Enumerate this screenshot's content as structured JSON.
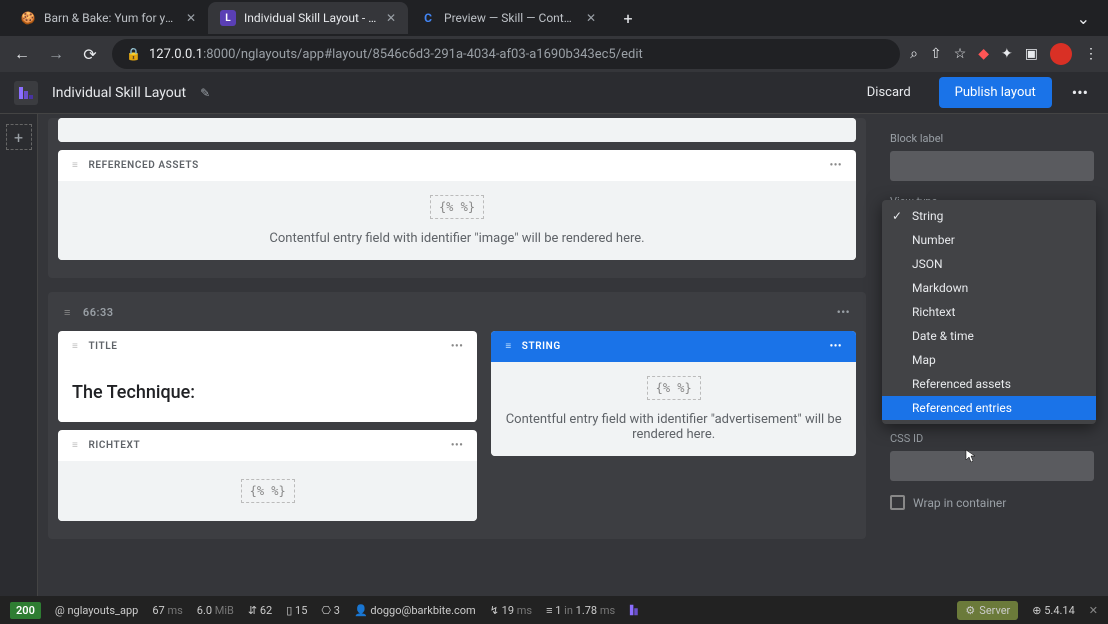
{
  "tabs": [
    {
      "title": "Barn & Bake: Yum for your Pup",
      "favicon": "🍪"
    },
    {
      "title": "Individual Skill Layout - Netge",
      "favicon": "L"
    },
    {
      "title": "Preview — Skill — Content Mod",
      "favicon": "C"
    }
  ],
  "address": {
    "host": "127.0.0.1",
    "port": ":8000",
    "path": "/nglayouts/app#layout/8546c6d3-291a-4034-af03-a1690b343ec5/edit"
  },
  "header": {
    "title": "Individual Skill Layout",
    "discard": "Discard",
    "publish": "Publish layout"
  },
  "blocks": {
    "ref_assets": {
      "label": "REFERENCED ASSETS",
      "body": "Contentful entry field with identifier \"image\" will be rendered here.",
      "twig": "{% %}"
    },
    "zone_ratio": "66:33",
    "title_block": {
      "label": "TITLE",
      "body": "The Technique:"
    },
    "richtext_block": {
      "label": "RICHTEXT",
      "twig": "{% %}"
    },
    "string_block": {
      "label": "STRING",
      "twig": "{% %}",
      "body": "Contentful entry field with identifier \"advertisement\" will be rendered here."
    }
  },
  "sidebar": {
    "block_label": "Block label",
    "view_type": "View type",
    "css_id": "CSS ID",
    "wrap": "Wrap in container",
    "options": [
      "String",
      "Number",
      "JSON",
      "Markdown",
      "Richtext",
      "Date & time",
      "Map",
      "Referenced assets",
      "Referenced entries"
    ]
  },
  "debug": {
    "status": "200",
    "route": "@ nglayouts_app",
    "time": "67",
    "time_unit": "ms",
    "mem": "6.0",
    "mem_unit": "MiB",
    "n1": "62",
    "n2": "15",
    "n3": "3",
    "user": "doggo@barkbite.com",
    "t2": "19",
    "t2_unit": "ms",
    "q": "1",
    "q_in": "in",
    "q_ms": "1.78",
    "q_unit": "ms",
    "server": "Server",
    "version": "5.4.14"
  }
}
